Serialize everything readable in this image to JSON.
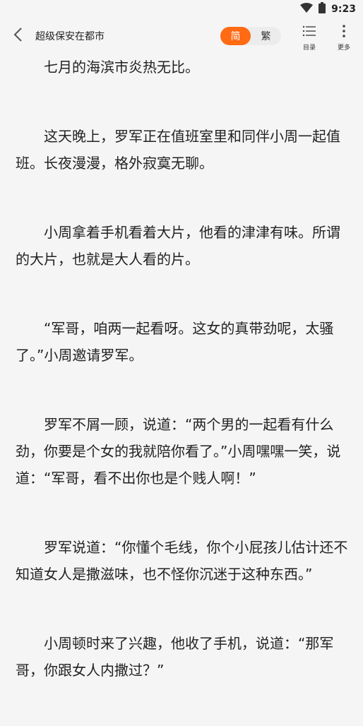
{
  "status": {
    "time": "9:23"
  },
  "header": {
    "title": "超级保安在都市",
    "toggle": {
      "simplified": "简",
      "traditional": "繁"
    },
    "toc_label": "目录",
    "more_label": "更多"
  },
  "colors": {
    "accent": "#ff6a13",
    "background": "#f5f5f5"
  },
  "icons": [
    "wifi-icon",
    "battery-icon",
    "chevron-left-icon",
    "list-icon",
    "more-vertical-icon"
  ],
  "paragraphs": [
    "七月的海滨市炎热无比。",
    "这天晚上，罗军正在值班室里和同伴小周一起值班。长夜漫漫，格外寂寞无聊。",
    "小周拿着手机看着大片，他看的津津有味。所谓的大片，也就是大人看的片。",
    "“军哥，咱两一起看呀。这女的真带劲呢，太骚了。”小周邀请罗军。",
    "罗军不屑一顾，说道：“两个男的一起看有什么劲，你要是个女的我就陪你看了。”小周嘿嘿一笑，说道：“军哥，看不出你也是个贱人啊！”",
    "罗军说道：“你懂个毛线，你个小屁孩儿估计还不知道女人是撒滋味，也不怪你沉迷于这种东西。”",
    "小周顿时来了兴趣，他收了手机，说道：“那军哥，你跟女人内撒过？”"
  ]
}
